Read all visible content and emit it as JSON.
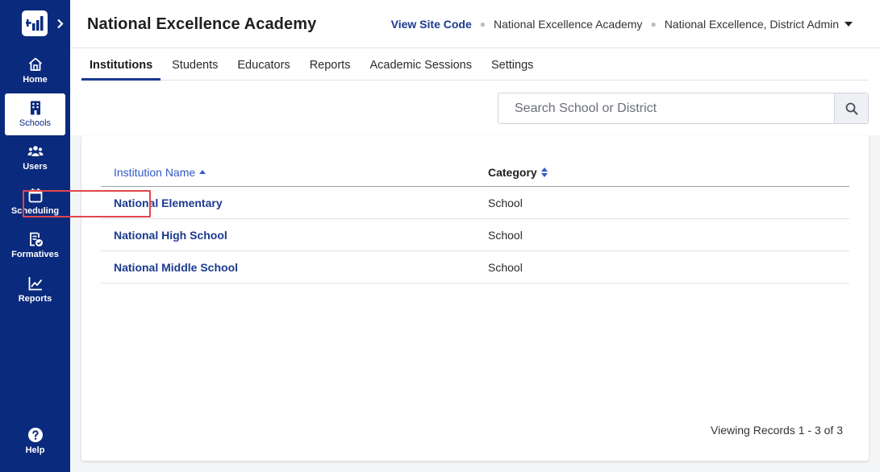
{
  "sidebar": {
    "items": [
      {
        "label": "Home",
        "icon": "home-icon"
      },
      {
        "label": "Schools",
        "icon": "building-icon",
        "active": true
      },
      {
        "label": "Users",
        "icon": "users-icon"
      },
      {
        "label": "Scheduling",
        "icon": "calendar-icon"
      },
      {
        "label": "Formatives",
        "icon": "clipboard-check-icon"
      },
      {
        "label": "Reports",
        "icon": "chart-line-icon"
      }
    ],
    "help": {
      "label": "Help",
      "icon": "help-icon"
    }
  },
  "header": {
    "title": "National Excellence Academy",
    "view_site_code": "View Site Code",
    "institution": "National Excellence Academy",
    "user": "National Excellence, District Admin"
  },
  "tabs": [
    {
      "label": "Institutions",
      "active": true
    },
    {
      "label": "Students"
    },
    {
      "label": "Educators"
    },
    {
      "label": "Reports"
    },
    {
      "label": "Academic Sessions"
    },
    {
      "label": "Settings"
    }
  ],
  "search": {
    "placeholder": "Search School or District"
  },
  "table": {
    "columns": {
      "name": "Institution Name",
      "category": "Category"
    },
    "rows": [
      {
        "name": "National Elementary",
        "category": "School"
      },
      {
        "name": "National High School",
        "category": "School"
      },
      {
        "name": "National Middle School",
        "category": "School"
      }
    ]
  },
  "footer": {
    "records": "Viewing Records 1 - 3 of 3"
  },
  "colors": {
    "sidebar": "#0a2a7d",
    "link": "#1b3a8f",
    "sort_header": "#3457c8",
    "highlight": "#e0474c"
  }
}
